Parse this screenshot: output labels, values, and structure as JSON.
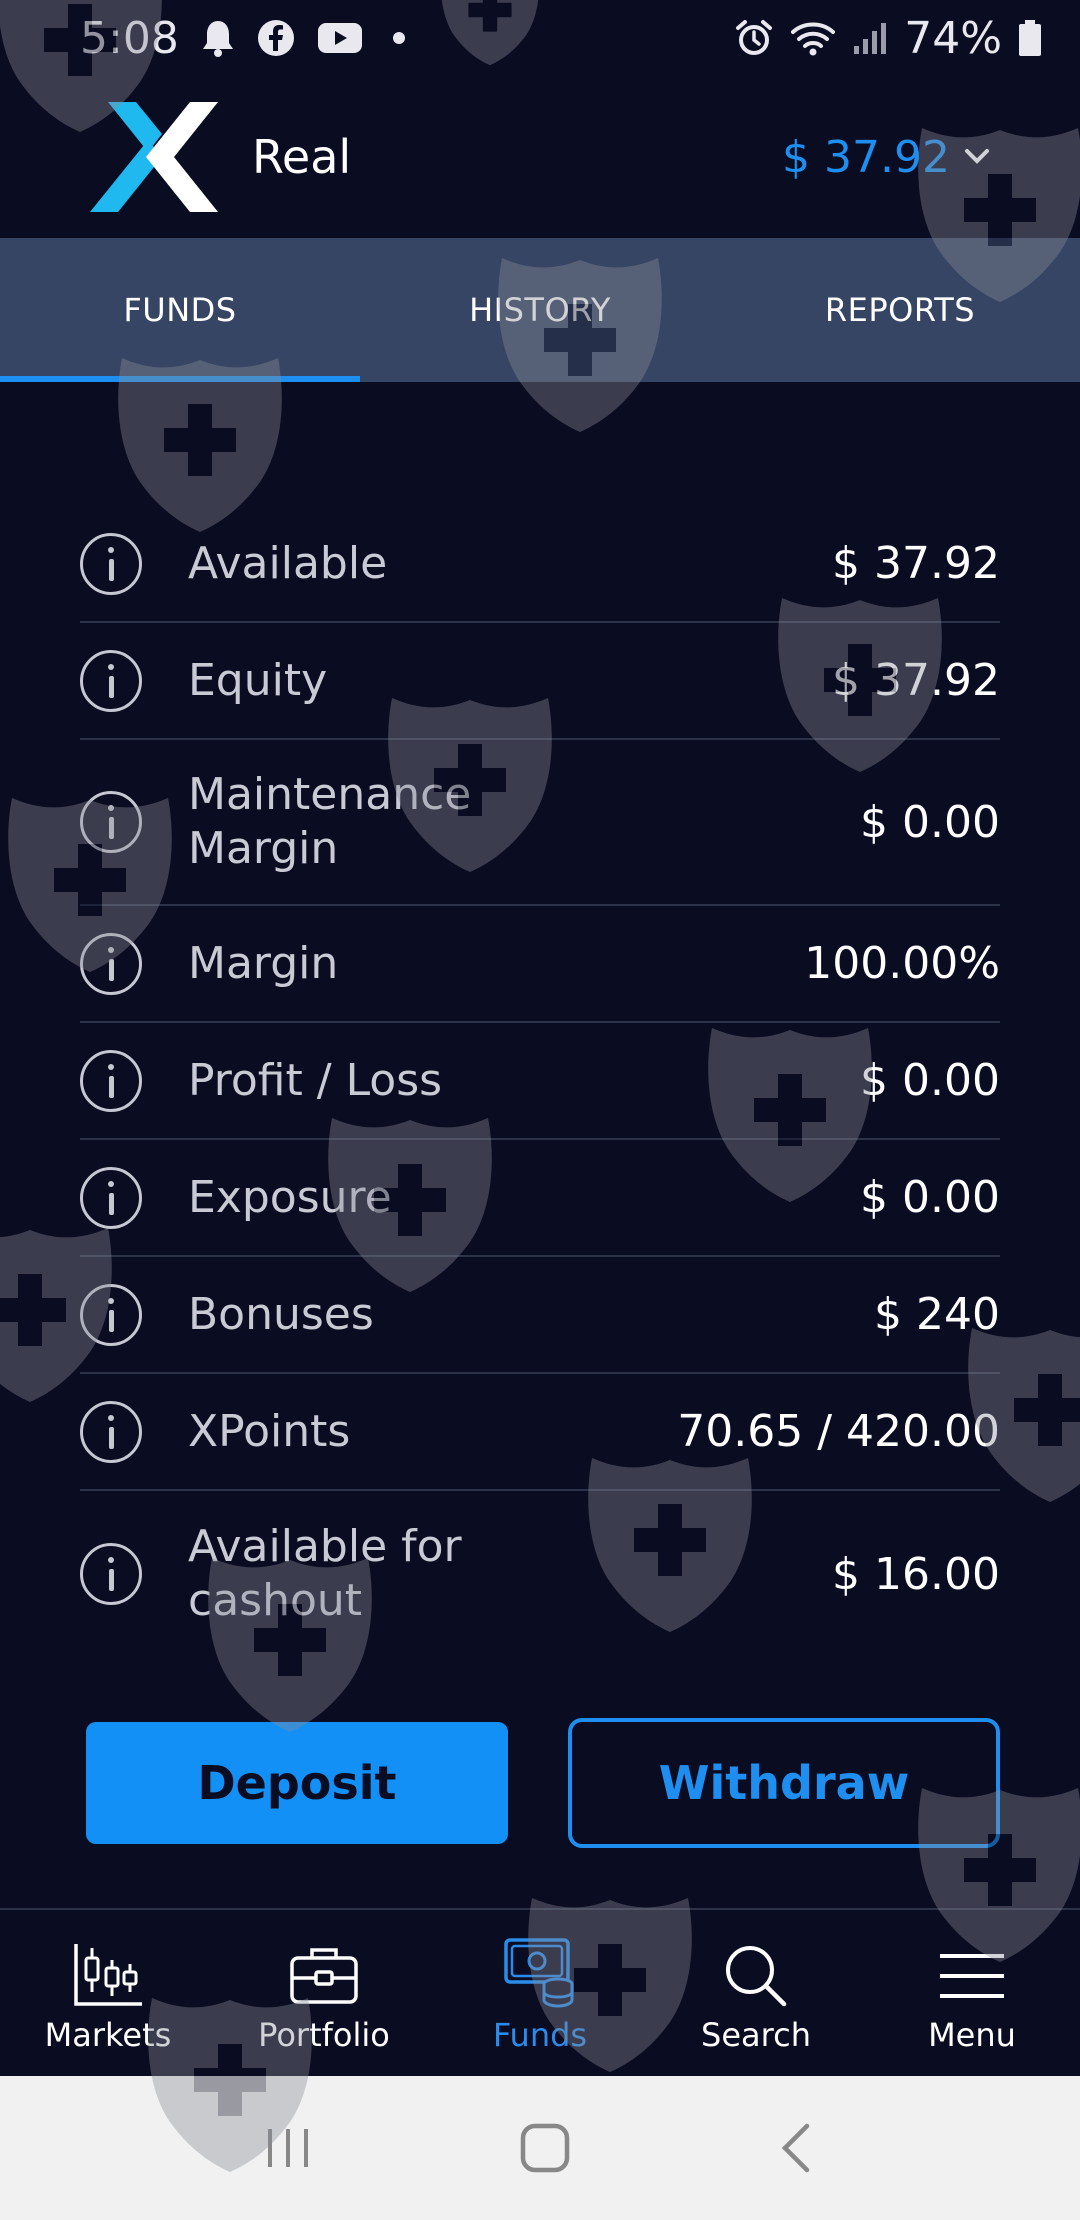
{
  "status_bar": {
    "time": "5:08",
    "battery": "74%",
    "left_icons": [
      "bell-icon",
      "facebook-icon",
      "youtube-icon",
      "dot-icon"
    ],
    "right_icons": [
      "alarm-icon",
      "wifi-icon",
      "signal-icon",
      "battery-icon"
    ]
  },
  "header": {
    "account_type": "Real",
    "balance": "$ 37.92"
  },
  "tabs": [
    {
      "label": "FUNDS",
      "active": true
    },
    {
      "label": "HISTORY",
      "active": false
    },
    {
      "label": "REPORTS",
      "active": false
    }
  ],
  "funds": [
    {
      "label": "Available",
      "value": "$ 37.92"
    },
    {
      "label": "Equity",
      "value": "$ 37.92"
    },
    {
      "label": "Maintenance Margin",
      "value": "$ 0.00"
    },
    {
      "label": "Margin",
      "value": "100.00%"
    },
    {
      "label": "Profit / Loss",
      "value": "$ 0.00"
    },
    {
      "label": "Exposure",
      "value": "$ 0.00"
    },
    {
      "label": "Bonuses",
      "value": "$ 240"
    },
    {
      "label": "XPoints",
      "value": "70.65 / 420.00"
    },
    {
      "label": "Available for cashout",
      "value": "$ 16.00"
    }
  ],
  "actions": {
    "deposit": "Deposit",
    "withdraw": "Withdraw"
  },
  "bottom_nav": [
    {
      "label": "Markets",
      "icon": "candlestick-chart-icon",
      "active": false
    },
    {
      "label": "Portfolio",
      "icon": "briefcase-icon",
      "active": false
    },
    {
      "label": "Funds",
      "icon": "money-coins-icon",
      "active": true
    },
    {
      "label": "Search",
      "icon": "search-icon",
      "active": false
    },
    {
      "label": "Menu",
      "icon": "hamburger-menu-icon",
      "active": false
    }
  ],
  "colors": {
    "background": "#0a0c22",
    "accent": "#1e8ff0",
    "tab_bar": "#364564"
  }
}
